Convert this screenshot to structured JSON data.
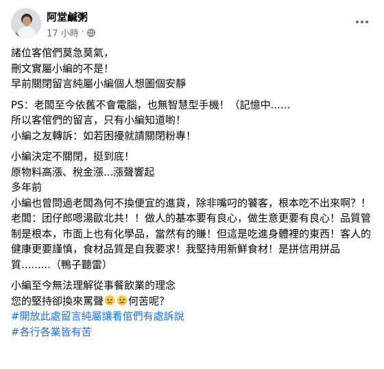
{
  "header": {
    "author": "阿堂鹹粥",
    "time": "17 小時",
    "separator": "·",
    "privacy_icon": "globe-icon",
    "more_icon": "more-options-icon"
  },
  "post": {
    "para1": [
      "諸位客倌們莫急莫氣，",
      "刪文實屬小編的不是！",
      "早前關閉留言純屬小編個人想圖個安靜"
    ],
    "para2": [
      "PS：老闆至今依舊不會電腦，也無智慧型手機！（記憶中......",
      "所以客倌們的留言，只有小編知道喲！",
      "小編之友轉訴：如若困擾就請關閉粉專！"
    ],
    "para3": {
      "line1": "小編決定不關閉，挺到底！",
      "line2": "原物料高漲、稅金漲...漲聲響起",
      "line3": "多年前",
      "line4": "小編也曾問過老闆為何不換便宜的進貨，除非嘴叼的饕客，根本吃不出來啊？！",
      "line5": "老闆：团仔郎嗯湯歐北共！！做人的基本要有良心，做生意更要有良心！品質管制是根本，市面上也有化學品，當然有的賺！但這是吃進身體裡的東西！客人的健康更要謹慎，食材品質是自我要求！我堅持用新鮮食材！是拼信用拼品質.........（鴨子聽雷）"
    },
    "para4": {
      "line1": "小編至今無法理解從事餐飲業的理念",
      "line2_before": "您的堅持卻換來罵聲",
      "emoji": "worried-face-emoji",
      "line2_after": "何苦呢？"
    },
    "hashtags": [
      "#開放此處留言純屬讓看倌們有處訴說",
      "#各行各業皆有苦"
    ]
  },
  "colors": {
    "text": "#050505",
    "secondary": "#65676b",
    "hashtag": "#216fdb"
  }
}
